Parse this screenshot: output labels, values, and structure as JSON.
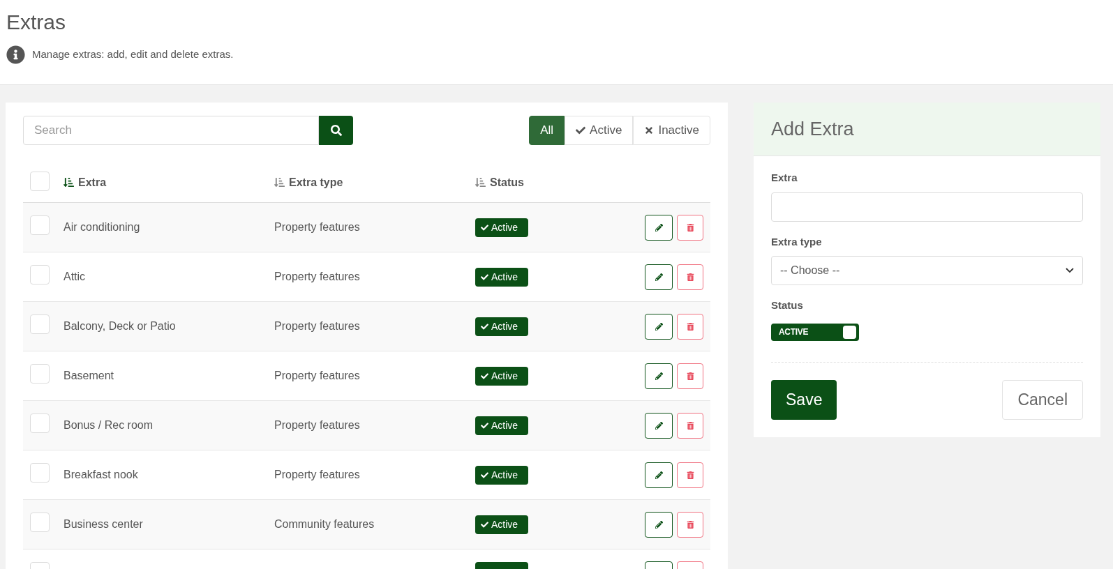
{
  "page": {
    "title": "Extras",
    "info": "Manage extras: add, edit and delete extras."
  },
  "search": {
    "placeholder": "Search"
  },
  "filters": [
    {
      "label": "All",
      "kind": "all",
      "selected": true
    },
    {
      "label": "Active",
      "kind": "active",
      "selected": false
    },
    {
      "label": "Inactive",
      "kind": "inactive",
      "selected": false
    }
  ],
  "table": {
    "select_all": {
      "checked": false
    },
    "columns": [
      {
        "label": "Extra",
        "sorted": true
      },
      {
        "label": "Extra type",
        "sorted": false
      },
      {
        "label": "Status",
        "sorted": false
      }
    ],
    "rows": [
      {
        "name": "Air conditioning",
        "type": "Property features",
        "status": "Active",
        "active": true,
        "checked": false
      },
      {
        "name": "Attic",
        "type": "Property features",
        "status": "Active",
        "active": true,
        "checked": false
      },
      {
        "name": "Balcony, Deck or Patio",
        "type": "Property features",
        "status": "Active",
        "active": true,
        "checked": false
      },
      {
        "name": "Basement",
        "type": "Property features",
        "status": "Active",
        "active": true,
        "checked": false
      },
      {
        "name": "Bonus / Rec room",
        "type": "Property features",
        "status": "Active",
        "active": true,
        "checked": false
      },
      {
        "name": "Breakfast nook",
        "type": "Property features",
        "status": "Active",
        "active": true,
        "checked": false
      },
      {
        "name": "Business center",
        "type": "Community features",
        "status": "Active",
        "active": true,
        "checked": false
      },
      {
        "active": true,
        "checked": false
      }
    ]
  },
  "form": {
    "title": "Add Extra",
    "extra": {
      "label": "Extra"
    },
    "extra_type": {
      "label": "Extra type",
      "value": "-- Choose --"
    },
    "status": {
      "label": "Status",
      "toggle": {
        "on": true,
        "text": "ACTIVE"
      }
    },
    "buttons": [
      {
        "kind": "primary",
        "label": "Save"
      },
      {
        "kind": "secondary",
        "label": "Cancel"
      }
    ]
  }
}
